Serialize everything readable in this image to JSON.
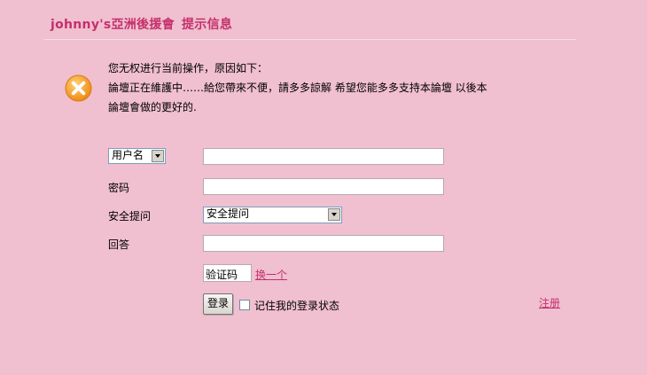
{
  "header": {
    "site_name": "johnny's亞洲後援會",
    "page_name": "提示信息"
  },
  "message": {
    "line1": "您无权进行当前操作，原因如下：",
    "line2": "論壇正在維護中……給您帶來不便，請多多諒解 希望您能多多支持本論壇 以後本",
    "line3": "論壇會做的更好的."
  },
  "login": {
    "username_select_value": "用户名",
    "password_label": "密码",
    "security_label": "安全提问",
    "security_select_value": "安全提问",
    "answer_label": "回答",
    "captcha_value": "验证码",
    "refresh_captcha_link": "换一个",
    "submit_label": "登录",
    "remember_label": "记住我的登录状态",
    "register_link": "注册"
  },
  "colors": {
    "background": "#f0bfd0",
    "accent": "#c4306b",
    "error_icon": "#f39a1d"
  },
  "icons": {
    "message_icon": "error-x-icon"
  }
}
